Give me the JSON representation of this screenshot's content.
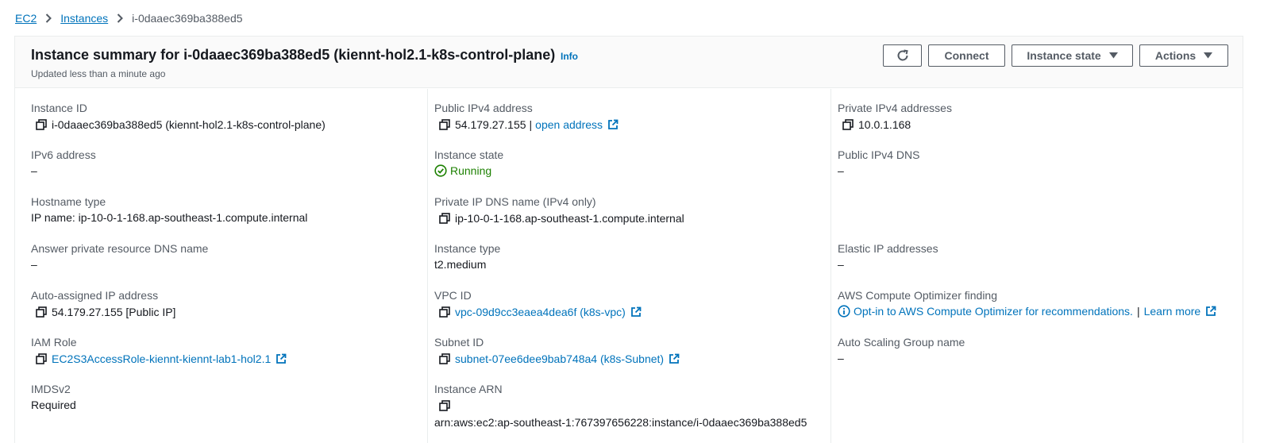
{
  "breadcrumb": {
    "items": [
      "EC2",
      "Instances"
    ],
    "current": "i-0daaec369ba388ed5"
  },
  "header": {
    "title": "Instance summary for i-0daaec369ba388ed5 (kiennt-hol2.1-k8s-control-plane)",
    "info": "Info",
    "updated": "Updated less than a minute ago",
    "buttons": {
      "refresh": "refresh-icon",
      "connect": "Connect",
      "instance_state": "Instance state",
      "actions": "Actions"
    }
  },
  "fields": {
    "instance_id": {
      "label": "Instance ID",
      "value": "i-0daaec369ba388ed5 (kiennt-hol2.1-k8s-control-plane)"
    },
    "ipv6": {
      "label": "IPv6 address",
      "value": "–"
    },
    "hostname_type": {
      "label": "Hostname type",
      "value": "IP name: ip-10-0-1-168.ap-southeast-1.compute.internal"
    },
    "answer_dns": {
      "label": "Answer private resource DNS name",
      "value": "–"
    },
    "auto_ip": {
      "label": "Auto-assigned IP address",
      "value": "54.179.27.155 [Public IP]"
    },
    "iam_role": {
      "label": "IAM Role",
      "value": "EC2S3AccessRole-kiennt-kiennt-lab1-hol2.1"
    },
    "imdsv2": {
      "label": "IMDSv2",
      "value": "Required"
    },
    "public_ipv4": {
      "label": "Public IPv4 address",
      "value": "54.179.27.155",
      "sep": "|",
      "link": "open address"
    },
    "instance_state": {
      "label": "Instance state",
      "value": "Running"
    },
    "private_dns": {
      "label": "Private IP DNS name (IPv4 only)",
      "value": "ip-10-0-1-168.ap-southeast-1.compute.internal"
    },
    "instance_type": {
      "label": "Instance type",
      "value": "t2.medium"
    },
    "vpc_id": {
      "label": "VPC ID",
      "value": "vpc-09d9cc3eaea4dea6f (k8s-vpc)"
    },
    "subnet_id": {
      "label": "Subnet ID",
      "value": "subnet-07ee6dee9bab748a4 (k8s-Subnet)"
    },
    "instance_arn": {
      "label": "Instance ARN",
      "value": "arn:aws:ec2:ap-southeast-1:767397656228:instance/i-0daaec369ba388ed5"
    },
    "private_ipv4": {
      "label": "Private IPv4 addresses",
      "value": "10.0.1.168"
    },
    "public_dns": {
      "label": "Public IPv4 DNS",
      "value": "–"
    },
    "elastic_ip": {
      "label": "Elastic IP addresses",
      "value": "–"
    },
    "optimizer": {
      "label": "AWS Compute Optimizer finding",
      "link": "Opt-in to AWS Compute Optimizer for recommendations.",
      "sep": "|",
      "learn": "Learn more"
    },
    "asg": {
      "label": "Auto Scaling Group name",
      "value": "–"
    }
  },
  "colors": {
    "link": "#0073bb",
    "running": "#1d8102",
    "text": "#16191f",
    "label": "#545b64"
  }
}
